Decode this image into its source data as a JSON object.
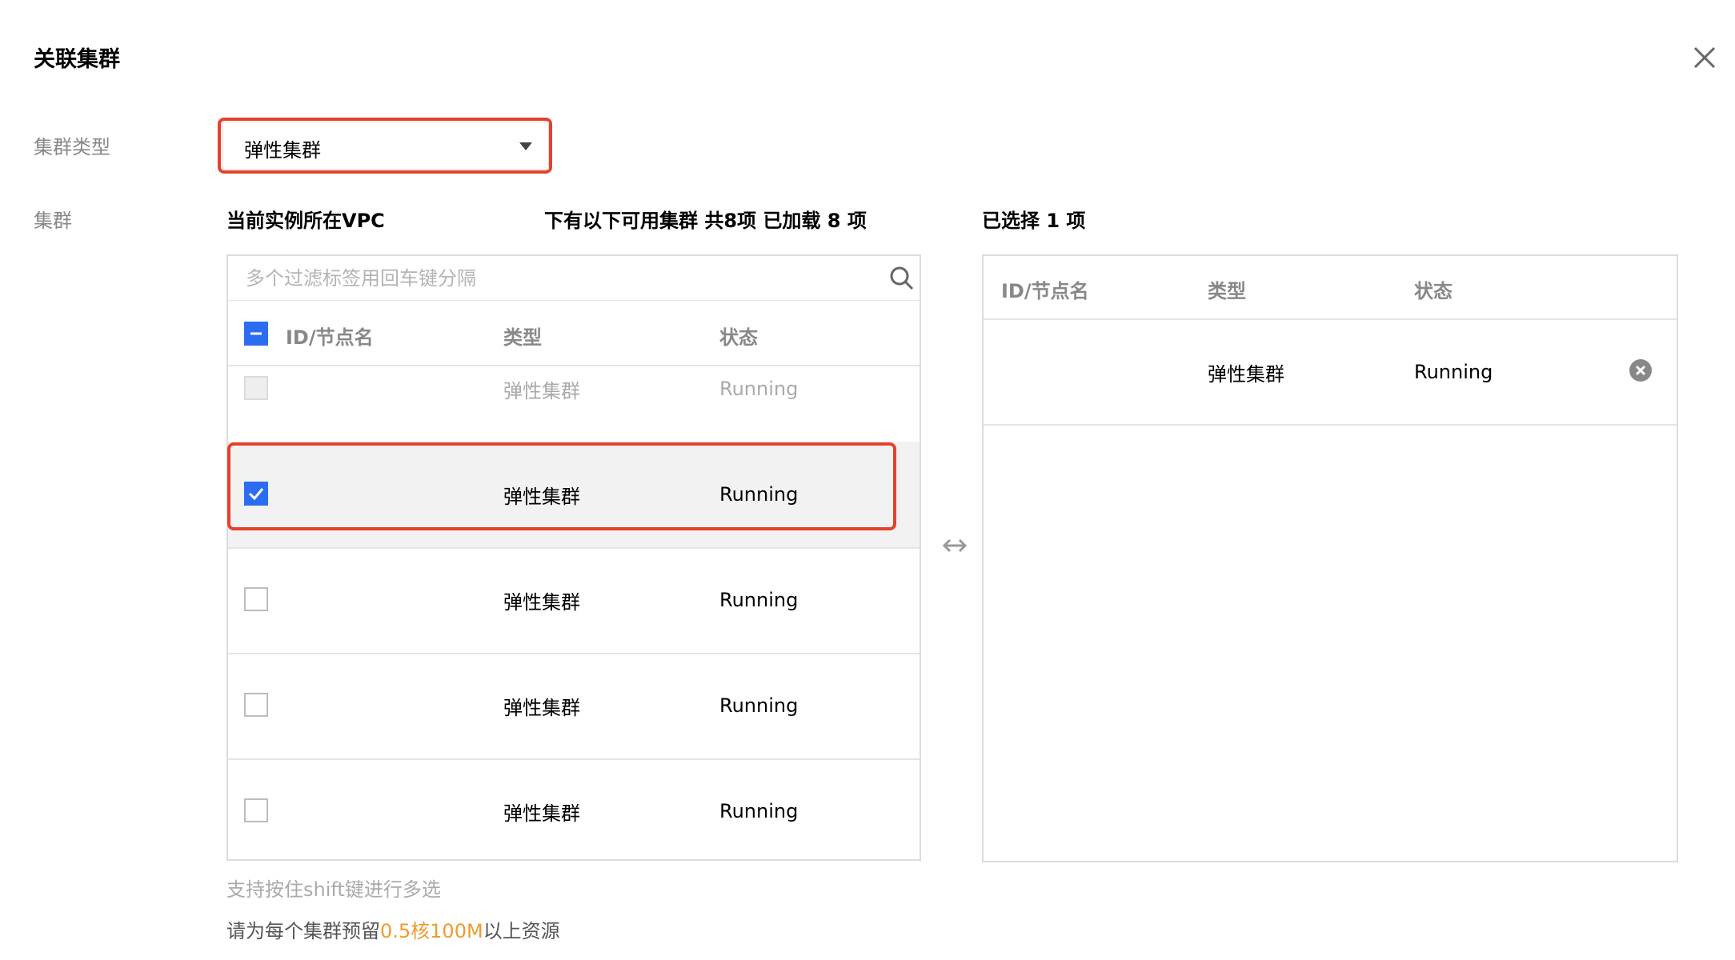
{
  "dialog": {
    "title": "关联集群"
  },
  "form": {
    "cluster_type_label": "集群类型",
    "cluster_label": "集群",
    "cluster_type_value": "弹性集群"
  },
  "left_panel": {
    "heading_vpc": "当前实例所在VPC",
    "heading_available": "下有以下可用集群 共8项 已加载 8 项",
    "search_placeholder": "多个过滤标签用回车键分隔",
    "columns": [
      "ID/节点名",
      "类型",
      "状态"
    ],
    "rows": [
      {
        "type": "弹性集群",
        "status": "Running",
        "checked": false,
        "disabled": true
      },
      {
        "type": "弹性集群",
        "status": "Running",
        "checked": true,
        "disabled": false
      },
      {
        "type": "弹性集群",
        "status": "Running",
        "checked": false,
        "disabled": false
      },
      {
        "type": "弹性集群",
        "status": "Running",
        "checked": false,
        "disabled": false
      },
      {
        "type": "弹性集群",
        "status": "Running",
        "checked": false,
        "disabled": false
      }
    ],
    "hint": "支持按住shift键进行多选",
    "resource_note_pre": "请为每个集群预留",
    "resource_note_accent": "0.5核100M",
    "resource_note_post": "以上资源"
  },
  "right_panel": {
    "heading": "已选择 1 项",
    "columns": [
      "ID/节点名",
      "类型",
      "状态"
    ],
    "rows": [
      {
        "type": "弹性集群",
        "status": "Running"
      }
    ]
  },
  "colors": {
    "accent": "#2b6df2",
    "highlight": "#e5412d",
    "warning": "#f19a2f"
  },
  "icons": [
    "close-icon",
    "chevron-down-icon",
    "search-icon",
    "transfer-icon",
    "remove-icon",
    "check-icon",
    "minus-icon"
  ]
}
